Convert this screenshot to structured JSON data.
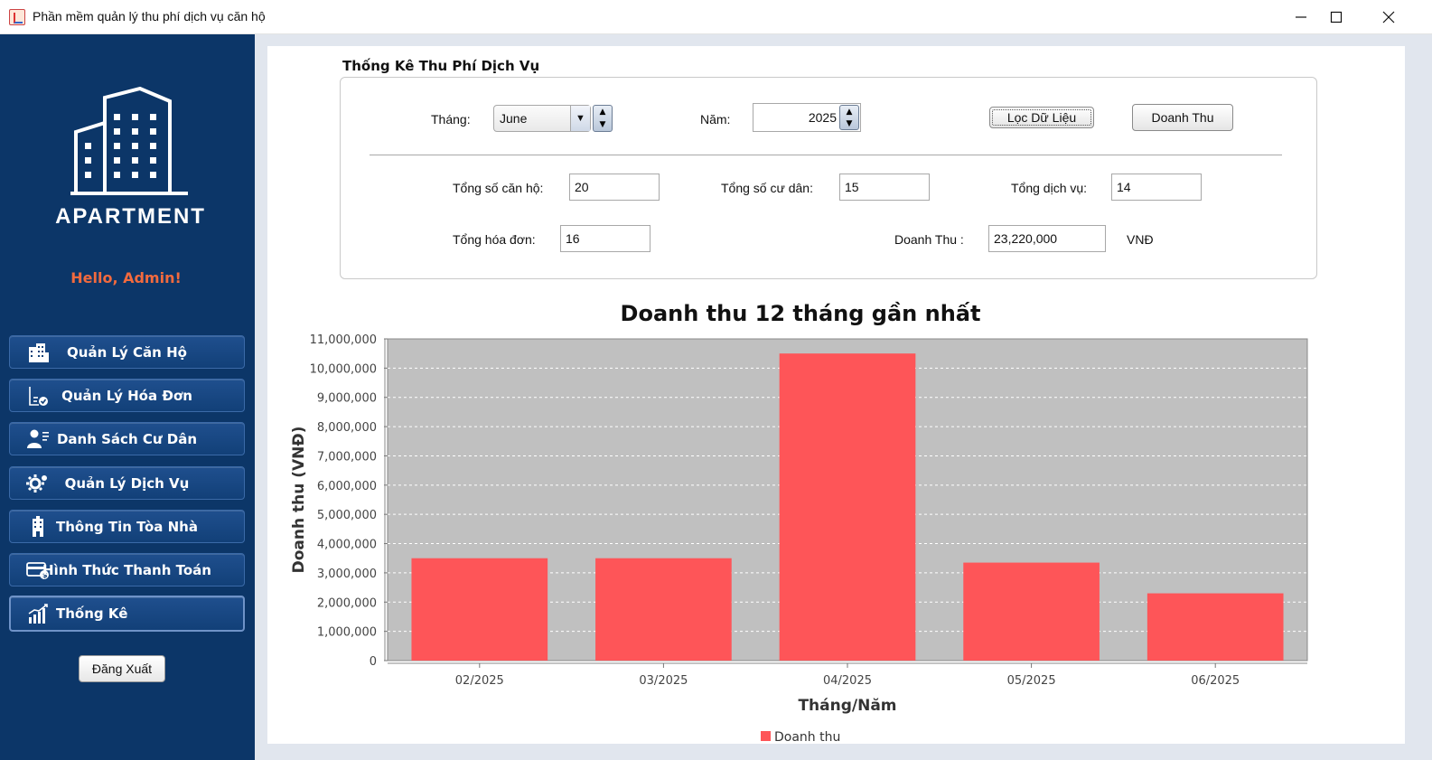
{
  "window": {
    "title": "Phần mềm quản lý thu phí dịch vụ căn hộ",
    "controls": [
      "minimize-icon",
      "maximize-icon",
      "close-icon"
    ]
  },
  "sidebar": {
    "logo_text": "APARTMENT",
    "greeting": "Hello, Admin!",
    "items": [
      {
        "label": "Quản Lý Căn Hộ",
        "icon": "building-icon",
        "active": false
      },
      {
        "label": "Quản Lý Hóa Đơn",
        "icon": "invoice-icon",
        "active": false
      },
      {
        "label": "Danh Sách Cư Dân",
        "icon": "residents-icon",
        "active": false
      },
      {
        "label": "Quản Lý Dịch Vụ",
        "icon": "service-gear-icon",
        "active": false
      },
      {
        "label": "Thông Tin Tòa Nhà",
        "icon": "tower-icon",
        "active": false
      },
      {
        "label": "Hình Thức Thanh Toán",
        "icon": "payment-card-icon",
        "active": false
      },
      {
        "label": "Thống Kê",
        "icon": "statistics-chart-icon",
        "active": true
      }
    ],
    "logout_label": "Đăng Xuất"
  },
  "stats": {
    "section_title": "Thống Kê Thu Phí Dịch Vụ",
    "month_label": "Tháng:",
    "month_value": "June",
    "year_label": "Năm:",
    "year_value": "2025",
    "filter_button": "Lọc Dữ Liệu",
    "revenue_button": "Doanh Thu",
    "total_apartments_label": "Tổng số căn hộ:",
    "total_apartments_value": "20",
    "total_residents_label": "Tổng số cư dân:",
    "total_residents_value": "15",
    "total_services_label": "Tổng dịch vụ:",
    "total_services_value": "14",
    "total_invoices_label": "Tổng hóa đơn:",
    "total_invoices_value": "16",
    "revenue_label": "Doanh Thu :",
    "revenue_value": "23,220,000",
    "currency": "VNĐ"
  },
  "chart_data": {
    "type": "bar",
    "title": "Doanh thu 12 tháng gần nhất",
    "xlabel": "Tháng/Năm",
    "ylabel": "Doanh thu (VNĐ)",
    "categories": [
      "02/2025",
      "03/2025",
      "04/2025",
      "05/2025",
      "06/2025"
    ],
    "series": [
      {
        "name": "Doanh thu",
        "values": [
          3500000,
          3500000,
          10500000,
          3350000,
          2300000
        ]
      }
    ],
    "ylim": [
      0,
      11000000
    ],
    "yticks": [
      "0",
      "1,000,000",
      "2,000,000",
      "3,000,000",
      "4,000,000",
      "5,000,000",
      "6,000,000",
      "7,000,000",
      "8,000,000",
      "9,000,000",
      "10,000,000",
      "11,000,000"
    ],
    "grid": true,
    "legend": "bottom",
    "bar_color": "#fe5558",
    "plot_background": "#c0c0c0"
  }
}
